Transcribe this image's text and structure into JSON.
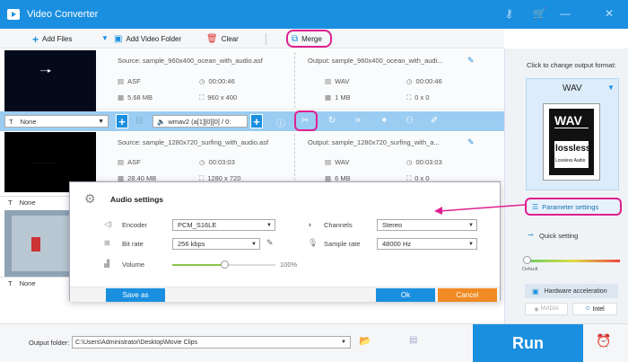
{
  "app": {
    "title": "Video Converter"
  },
  "window_controls": [
    "key-icon",
    "cart-icon",
    "minimize-icon",
    "close-icon"
  ],
  "toolbar": {
    "add_files": "Add Files",
    "add_video_folder": "Add Video Folder",
    "clear": "Clear",
    "merge": "Merge"
  },
  "files": [
    {
      "source": "Source: sample_960x400_ocean_with_audio.asf",
      "src_format": "ASF",
      "src_duration": "00:00:46",
      "src_size": "5.68 MB",
      "src_resolution": "960 x 400",
      "output": "Output: sample_960x400_ocean_with_audi...",
      "out_format": "WAV",
      "out_duration": "00:00:46",
      "out_size": "1 MB",
      "out_resolution": "0 x 0"
    },
    {
      "source": "Source: sample_1280x720_surfing_with_audio.asf",
      "src_format": "ASF",
      "src_duration": "00:03:03",
      "src_size": "28.40 MB",
      "src_resolution": "1280 x 720",
      "output": "Output: sample_1280x720_surfing_with_a...",
      "out_format": "WAV",
      "out_duration": "00:03:03",
      "out_size": "6 MB",
      "out_resolution": "0 x 0"
    }
  ],
  "edit_bar": {
    "subtitle": "None",
    "audio_track": "wmav2 (a[1][0][0] / 0:"
  },
  "item_subtitle": [
    "None",
    "None"
  ],
  "audio_settings": {
    "title": "Audio settings",
    "encoder_label": "Encoder",
    "encoder_value": "PCM_S16LE",
    "channels_label": "Channels",
    "channels_value": "Stereo",
    "bitrate_label": "Bit rate",
    "bitrate_value": "256 kbps",
    "samplerate_label": "Sample rate",
    "samplerate_value": "48000 Hz",
    "volume_label": "Volume",
    "volume_value": "100%",
    "volume_level": 0.5,
    "save_as": "Save as",
    "ok": "Ok",
    "cancel": "Cancel"
  },
  "right_panel": {
    "hint": "Click to change output format:",
    "format": "WAV",
    "format_icon_text": "WAV",
    "lossless_big": "lossless",
    "lossless_small": "Lossless Audio",
    "param_settings": "Parameter settings",
    "quick_setting": "Quick setting",
    "default_label": "Default",
    "hw_accel": "Hardware acceleration",
    "nvidia": "NVIDIA",
    "intel": "Intel"
  },
  "bottom": {
    "output_folder_label": "Output folder:",
    "output_path": "C:\\Users\\Administrator\\Desktop\\Movie Clips",
    "run": "Run"
  },
  "colors": {
    "accent": "#1a8fe0",
    "highlight": "#e0208f",
    "cancel": "#f08a24"
  }
}
